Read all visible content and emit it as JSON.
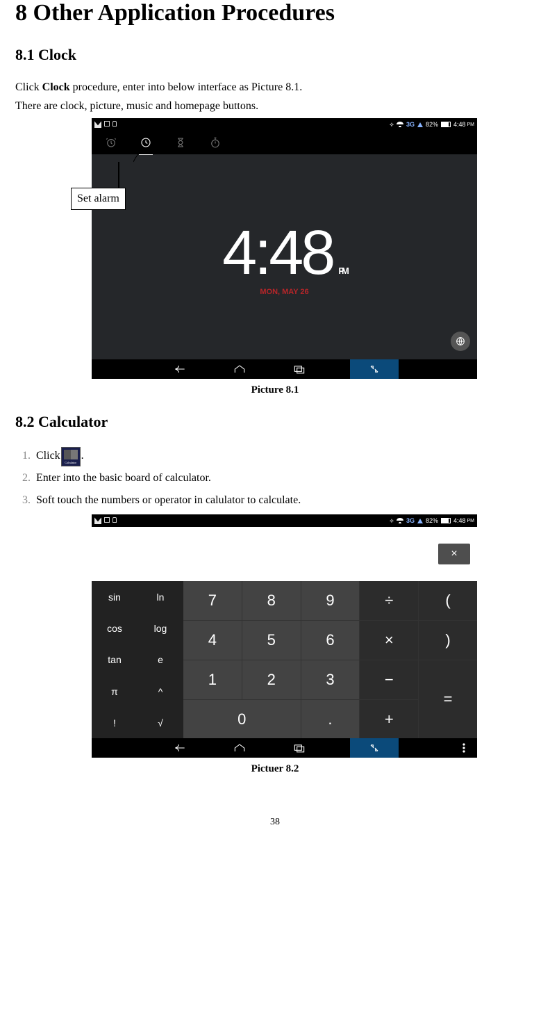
{
  "h1": "8 Other Application Procedures",
  "s1": {
    "heading": "8.1 Clock",
    "p1a": "Click ",
    "p1b": "Clock",
    "p1c": " procedure, enter into below interface as Picture 8.1.",
    "p2": "There are clock, picture, music and homepage buttons.",
    "callout": "Set alarm",
    "status": {
      "tg": "3G",
      "pct": "82%",
      "time": "4:48",
      "ampm": "PM"
    },
    "time": "4:48",
    "timeampm": "PM",
    "date": "MON, MAY 26",
    "caption": "Picture 8.1"
  },
  "s2": {
    "heading": "8.2 Calculator",
    "steps": {
      "n1": "1.",
      "t1a": "Click",
      "t1b": ".",
      "n2": "2.",
      "t2": "Enter into the basic board of calculator.",
      "n3": "3.",
      "t3": "Soft touch the numbers or operator in calulator to calculate."
    },
    "status": {
      "tg": "3G",
      "pct": "82%",
      "time": "4:48",
      "ampm": "PM"
    },
    "del": "×",
    "sci": {
      "sin": "sin",
      "ln": "ln",
      "cos": "cos",
      "log": "log",
      "tan": "tan",
      "e": "e",
      "pi": "π",
      "pow": "^",
      "fact": "!",
      "sqrt": "√"
    },
    "keys": {
      "k7": "7",
      "k8": "8",
      "k9": "9",
      "div": "÷",
      "lp": "(",
      "k4": "4",
      "k5": "5",
      "k6": "6",
      "mul": "×",
      "rp": ")",
      "k1": "1",
      "k2": "2",
      "k3": "3",
      "sub": "−",
      "eq": "=",
      "k0": "0",
      "dot": ".",
      "add": "+"
    },
    "caption": "Pictuer 8.2"
  },
  "pageno": "38"
}
